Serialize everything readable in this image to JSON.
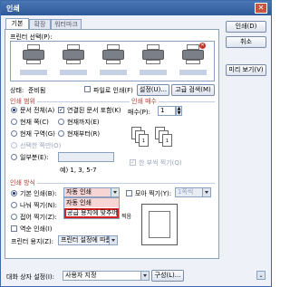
{
  "window": {
    "title": "인쇄",
    "close": "✕"
  },
  "tabs": [
    "기본",
    "확장",
    "워터마크"
  ],
  "right_buttons": [
    "인쇄(D)",
    "취소",
    "미리 보기(V)"
  ],
  "printer_select_label": "프린터 선택(P):",
  "printers": [
    {
      "name": "",
      "error": false
    },
    {
      "name": "",
      "error": false
    },
    {
      "name": "",
      "error": false
    },
    {
      "name": "",
      "error": false
    },
    {
      "name": "",
      "error": true
    }
  ],
  "status": {
    "label": "상태:",
    "value": "준비됨"
  },
  "print_to_file": "파일로 인쇄(F)",
  "settings_button": "설정(U)...",
  "advanced_settings_button": "고급 검색(M)",
  "range": {
    "title": "인쇄 범위",
    "options": [
      "문서 전체(A)",
      "현재 쪽(C)",
      "현재 구역(G)",
      "선택한 쪽만(O)",
      "일부분(E):"
    ],
    "options_right": [
      "연결된 문서 포함(K)",
      "현재까지(E)",
      "현재부터(R)"
    ],
    "example": "예) 1, 3, 5-7"
  },
  "copies": {
    "title": "인쇄 매수",
    "label": "매수(P):",
    "value": "1",
    "collate": "한 부씩 찍기(Q)"
  },
  "method": {
    "title": "인쇄 방식",
    "basic": "기본 인쇄(B):",
    "basic_value": "자동 인쇄",
    "split": "나눠 찍기(N):",
    "split_value": "용지에 맞추어",
    "fold": "접어 찍기(Z):",
    "reverse": "역순 인쇄(I)",
    "paper_label": "프린터 용지(Z):",
    "paper_value": "프린터 설정에 따름",
    "overlap": "모아 찍기(Y):",
    "overlap_value": "1쪽씩",
    "dropdown_items": [
      "자동 인쇄",
      "공급 용지에 맞추어"
    ],
    "truncated": "찍음"
  },
  "footer": {
    "label": "대화 상자 설정(I):",
    "value": "사용자 지정",
    "config_button": "구성(L)..."
  }
}
